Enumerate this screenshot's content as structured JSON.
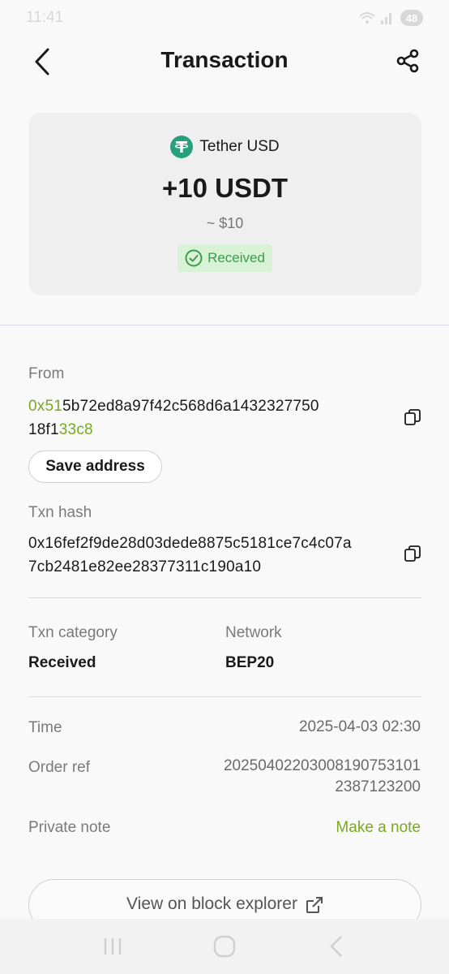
{
  "status_bar": {
    "time": "11:41",
    "battery": "48"
  },
  "header": {
    "title": "Transaction"
  },
  "summary": {
    "token_name": "Tether USD",
    "amount": "+10 USDT",
    "fiat_value": "~ $10",
    "status": "Received",
    "token_color": "#26a17b",
    "status_color": "#3b9d4b"
  },
  "from": {
    "label": "From",
    "address_prefix": "0x51",
    "address_mid_line1": "5b72ed8a97f42c568d6a1432327750",
    "address_mid_line2": "18f1",
    "address_suffix": "33c8",
    "save_button": "Save address"
  },
  "txn_hash": {
    "label": "Txn hash",
    "line1": "0x16fef2f9de28d03dede8875c5181ce7c4c07a",
    "line2": "7cb2481e82ee28377311c190a10"
  },
  "details": {
    "category_label": "Txn category",
    "category_value": "Received",
    "network_label": "Network",
    "network_value": "BEP20",
    "time_label": "Time",
    "time_value": "2025-04-03 02:30",
    "order_ref_label": "Order ref",
    "order_ref_line1": "20250402203008190753101",
    "order_ref_line2": "2387123200",
    "note_label": "Private note",
    "note_action": "Make a note"
  },
  "explorer_button": "View on block explorer",
  "accent_color": "#7aa81e"
}
